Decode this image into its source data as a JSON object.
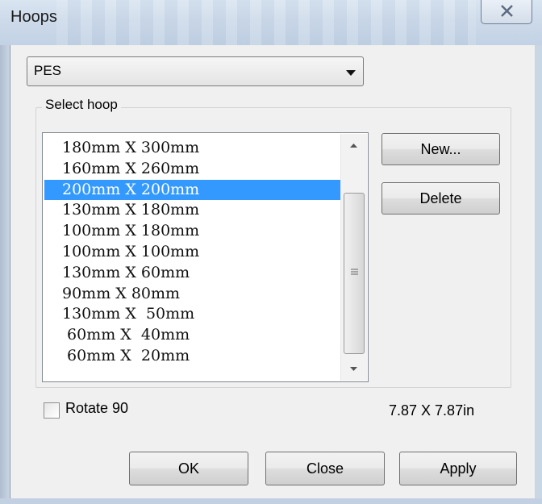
{
  "window": {
    "title": "Hoops",
    "close_icon": "x-close-icon"
  },
  "format_select": {
    "value": "PES",
    "icon": "dropdown-arrow-icon"
  },
  "hoop_group": {
    "label": "Select hoop",
    "items": [
      "180mm X 300mm",
      "160mm X 260mm",
      "200mm X 200mm",
      "130mm X 180mm",
      "100mm X 180mm",
      "100mm X 100mm",
      "130mm X 60mm",
      "90mm X 80mm",
      "130mm X  50mm",
      " 60mm X  40mm",
      " 60mm X  20mm"
    ],
    "selected_index": 2,
    "selection_color": "#3399ff"
  },
  "actions": {
    "new_label": "New...",
    "delete_label": "Delete"
  },
  "options": {
    "rotate_label": "Rotate 90",
    "rotate_checked": false,
    "size_readout": "7.87 X 7.87in"
  },
  "footer": {
    "ok_label": "OK",
    "close_label": "Close",
    "apply_label": "Apply"
  }
}
